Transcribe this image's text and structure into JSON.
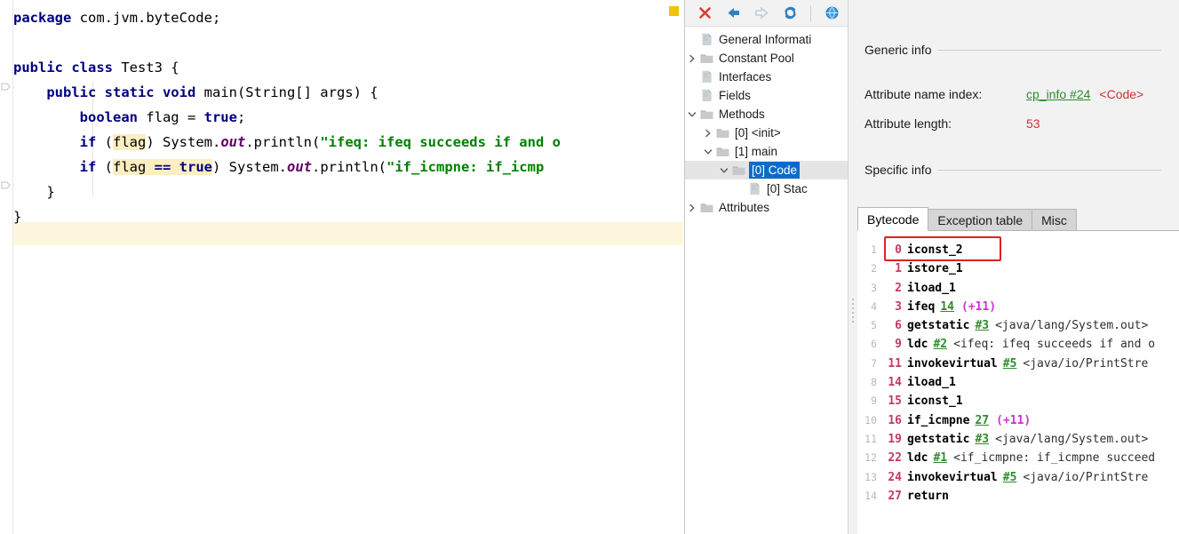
{
  "editor": {
    "marker_icon": "warning-marker",
    "lines": [
      {
        "id": 1,
        "tokens": [
          {
            "t": "package",
            "c": "kw"
          },
          {
            "t": " com.jvm.byteCode;",
            "c": "plain"
          }
        ]
      },
      {
        "id": 2,
        "tokens": []
      },
      {
        "id": 3,
        "tokens": [
          {
            "t": "public class",
            "c": "kw"
          },
          {
            "t": " Test3 {",
            "c": "plain"
          }
        ]
      },
      {
        "id": 4,
        "tokens": [
          {
            "t": "    ",
            "c": "plain"
          },
          {
            "t": "public static void",
            "c": "kw"
          },
          {
            "t": " main(String[] args) {",
            "c": "plain"
          }
        ]
      },
      {
        "id": 5,
        "tokens": [
          {
            "t": "        ",
            "c": "plain"
          },
          {
            "t": "boolean",
            "c": "kw"
          },
          {
            "t": " flag = ",
            "c": "plain"
          },
          {
            "t": "true",
            "c": "kw"
          },
          {
            "t": ";",
            "c": "plain"
          }
        ]
      },
      {
        "id": 6,
        "tokens": [
          {
            "t": "        ",
            "c": "plain"
          },
          {
            "t": "if",
            "c": "kw"
          },
          {
            "t": " (",
            "c": "plain"
          },
          {
            "t": "flag",
            "c": "plain hl-ident"
          },
          {
            "t": ") System.",
            "c": "plain"
          },
          {
            "t": "out",
            "c": "fld"
          },
          {
            "t": ".println(",
            "c": "plain"
          },
          {
            "t": "\"ifeq: ifeq succeeds if and o",
            "c": "str"
          }
        ]
      },
      {
        "id": 7,
        "tokens": [
          {
            "t": "        ",
            "c": "plain"
          },
          {
            "t": "if",
            "c": "kw"
          },
          {
            "t": " (",
            "c": "plain"
          },
          {
            "t": "flag ",
            "c": "plain hl-ident"
          },
          {
            "t": "== ",
            "c": "kw hl-ident"
          },
          {
            "t": "true",
            "c": "kw hl-ident"
          },
          {
            "t": ") System.",
            "c": "plain"
          },
          {
            "t": "out",
            "c": "fld"
          },
          {
            "t": ".println(",
            "c": "plain"
          },
          {
            "t": "\"if_icmpne: if_icmp",
            "c": "str"
          }
        ]
      },
      {
        "id": 8,
        "tokens": [
          {
            "t": "    }",
            "c": "plain"
          }
        ]
      },
      {
        "id": 9,
        "tokens": [
          {
            "t": "}",
            "c": "plain"
          }
        ]
      }
    ]
  },
  "toolbar": {
    "buttons": [
      {
        "name": "close-icon",
        "label": "Close",
        "color": "#e03c31"
      },
      {
        "name": "back-arrow-icon",
        "label": "Back",
        "color": "#2d7fc1"
      },
      {
        "name": "forward-arrow-icon",
        "label": "Forward",
        "color": "#c6d3dc"
      },
      {
        "name": "reload-icon",
        "label": "Reload",
        "color": "#2d7fc1"
      },
      {
        "name": "browse-globe-icon",
        "label": "Browse",
        "color": "#2d8fd6"
      }
    ]
  },
  "tree": {
    "items": [
      {
        "label": "General Informati",
        "twisty": "none",
        "icon": "file-icon",
        "indent": 0,
        "selected": false
      },
      {
        "label": "Constant Pool",
        "twisty": "collapsed",
        "icon": "folder-icon",
        "indent": 0,
        "selected": false
      },
      {
        "label": "Interfaces",
        "twisty": "none",
        "icon": "file-icon",
        "indent": 0,
        "selected": false
      },
      {
        "label": "Fields",
        "twisty": "none",
        "icon": "file-icon",
        "indent": 0,
        "selected": false
      },
      {
        "label": "Methods",
        "twisty": "expanded",
        "icon": "folder-icon",
        "indent": 0,
        "selected": false
      },
      {
        "label": "[0] <init>",
        "twisty": "collapsed",
        "icon": "folder-icon",
        "indent": 1,
        "selected": false
      },
      {
        "label": "[1] main",
        "twisty": "expanded",
        "icon": "folder-icon",
        "indent": 1,
        "selected": false
      },
      {
        "label": "[0] Code",
        "twisty": "expanded",
        "icon": "folder-icon",
        "indent": 2,
        "selected": true
      },
      {
        "label": "[0] Stac",
        "twisty": "none",
        "icon": "file-icon",
        "indent": 3,
        "selected": false
      },
      {
        "label": "Attributes",
        "twisty": "collapsed",
        "icon": "folder-icon",
        "indent": 0,
        "selected": false
      }
    ]
  },
  "detail": {
    "generic_info_title": "Generic info",
    "attribute_name_index_label": "Attribute name index:",
    "attribute_name_index_link": "cp_info #24",
    "attribute_name_index_desc": "<Code>",
    "attribute_length_label": "Attribute length:",
    "attribute_length_value": "53",
    "specific_info_title": "Specific info",
    "tabs": [
      {
        "label": "Bytecode",
        "active": true
      },
      {
        "label": "Exception table",
        "active": false
      },
      {
        "label": "Misc",
        "active": false
      }
    ]
  },
  "bytecode": {
    "highlight_row": 1,
    "rows": [
      {
        "line": "1",
        "offset": "0",
        "mnemonic": "iconst_2",
        "ref": "",
        "delta": "",
        "desc": ""
      },
      {
        "line": "2",
        "offset": "1",
        "mnemonic": "istore_1",
        "ref": "",
        "delta": "",
        "desc": ""
      },
      {
        "line": "3",
        "offset": "2",
        "mnemonic": "iload_1",
        "ref": "",
        "delta": "",
        "desc": ""
      },
      {
        "line": "4",
        "offset": "3",
        "mnemonic": "ifeq",
        "ref": "14",
        "delta": "(+11)",
        "desc": ""
      },
      {
        "line": "5",
        "offset": "6",
        "mnemonic": "getstatic",
        "ref": "#3",
        "delta": "",
        "desc": "<java/lang/System.out>"
      },
      {
        "line": "6",
        "offset": "9",
        "mnemonic": "ldc",
        "ref": "#2",
        "delta": "",
        "desc": "<ifeq: ifeq succeeds if and o"
      },
      {
        "line": "7",
        "offset": "11",
        "mnemonic": "invokevirtual",
        "ref": "#5",
        "delta": "",
        "desc": "<java/io/PrintStre"
      },
      {
        "line": "8",
        "offset": "14",
        "mnemonic": "iload_1",
        "ref": "",
        "delta": "",
        "desc": ""
      },
      {
        "line": "9",
        "offset": "15",
        "mnemonic": "iconst_1",
        "ref": "",
        "delta": "",
        "desc": ""
      },
      {
        "line": "10",
        "offset": "16",
        "mnemonic": "if_icmpne",
        "ref": "27",
        "delta": "(+11)",
        "desc": ""
      },
      {
        "line": "11",
        "offset": "19",
        "mnemonic": "getstatic",
        "ref": "#3",
        "delta": "",
        "desc": "<java/lang/System.out>"
      },
      {
        "line": "12",
        "offset": "22",
        "mnemonic": "ldc",
        "ref": "#1",
        "delta": "",
        "desc": "<if_icmpne: if_icmpne succeed"
      },
      {
        "line": "13",
        "offset": "24",
        "mnemonic": "invokevirtual",
        "ref": "#5",
        "delta": "",
        "desc": "<java/io/PrintStre"
      },
      {
        "line": "14",
        "offset": "27",
        "mnemonic": "return",
        "ref": "",
        "delta": "",
        "desc": ""
      }
    ]
  }
}
